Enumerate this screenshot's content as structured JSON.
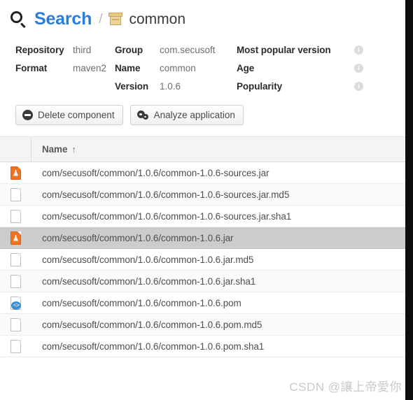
{
  "breadcrumb": {
    "search_label": "Search",
    "separator": "/",
    "component_label": "common",
    "search_icon": "search-icon",
    "package_icon": "package-box-icon"
  },
  "details": {
    "rows": [
      {
        "c1_label": "Repository",
        "c1_value": "third",
        "c2_label": "Group",
        "c2_value": "com.secusoft",
        "c3_label": "Most popular version",
        "c3_info": "i"
      },
      {
        "c1_label": "Format",
        "c1_value": "maven2",
        "c2_label": "Name",
        "c2_value": "common",
        "c3_label": "Age",
        "c3_info": "i"
      },
      {
        "c1_label": "",
        "c1_value": "",
        "c2_label": "Version",
        "c2_value": "1.0.6",
        "c3_label": "Popularity",
        "c3_info": "i"
      }
    ]
  },
  "actions": {
    "delete_label": "Delete component",
    "delete_icon": "delete-circle-icon",
    "analyze_label": "Analyze application",
    "analyze_icon": "gears-icon"
  },
  "assets_table": {
    "header": {
      "name_label": "Name",
      "sort_arrow": "↑"
    },
    "rows": [
      {
        "icon": "jar",
        "name": "com/secusoft/common/1.0.6/common-1.0.6-sources.jar",
        "selected": false
      },
      {
        "icon": "file",
        "name": "com/secusoft/common/1.0.6/common-1.0.6-sources.jar.md5",
        "selected": false
      },
      {
        "icon": "file",
        "name": "com/secusoft/common/1.0.6/common-1.0.6-sources.jar.sha1",
        "selected": false
      },
      {
        "icon": "jar",
        "name": "com/secusoft/common/1.0.6/common-1.0.6.jar",
        "selected": true
      },
      {
        "icon": "file",
        "name": "com/secusoft/common/1.0.6/common-1.0.6.jar.md5",
        "selected": false
      },
      {
        "icon": "file",
        "name": "com/secusoft/common/1.0.6/common-1.0.6.jar.sha1",
        "selected": false
      },
      {
        "icon": "pom",
        "name": "com/secusoft/common/1.0.6/common-1.0.6.pom",
        "selected": false
      },
      {
        "icon": "file",
        "name": "com/secusoft/common/1.0.6/common-1.0.6.pom.md5",
        "selected": false
      },
      {
        "icon": "file",
        "name": "com/secusoft/common/1.0.6/common-1.0.6.pom.sha1",
        "selected": false
      }
    ]
  },
  "watermark": {
    "text": "CSDN @讓上帝愛你"
  },
  "colors": {
    "link_blue": "#2a7ddb",
    "jar_orange": "#f0741f",
    "pom_blue": "#3d8fd1",
    "selected_row": "#cccccc",
    "package_gold": "#edd39a"
  }
}
